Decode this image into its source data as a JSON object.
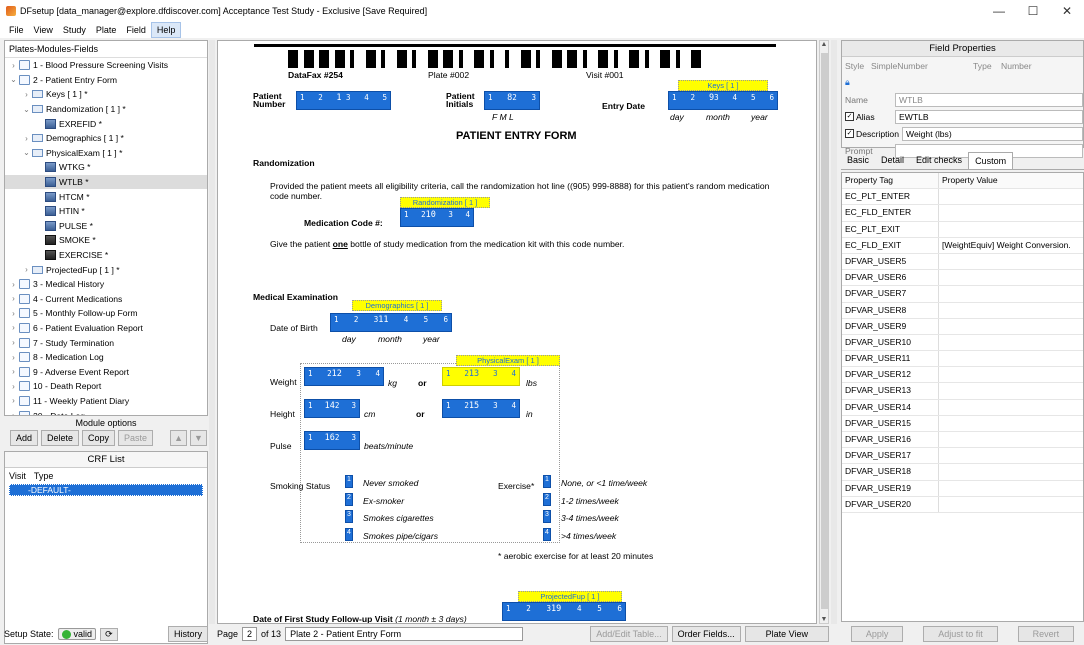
{
  "window": {
    "title": "DFsetup [data_manager@explore.dfdiscover.com] Acceptance Test Study - Exclusive [Save Required]",
    "minimize": "—",
    "maximize": "☐",
    "close": "✕"
  },
  "menu": [
    "File",
    "View",
    "Study",
    "Plate",
    "Field",
    "Help"
  ],
  "tree": {
    "header": "Plates-Modules-Fields",
    "items": [
      {
        "label": "1 - Blood Pressure Screening Visits",
        "depth": 0,
        "tw": "›",
        "icon": "doc"
      },
      {
        "label": "2 - Patient Entry Form",
        "depth": 0,
        "tw": "⌄",
        "icon": "doc"
      },
      {
        "label": "Keys [ 1 ] *",
        "depth": 1,
        "tw": "›",
        "icon": "mod"
      },
      {
        "label": "Randomization [ 1 ] *",
        "depth": 1,
        "tw": "⌄",
        "icon": "mod"
      },
      {
        "label": "EXREFID *",
        "depth": 2,
        "tw": "",
        "icon": "fld"
      },
      {
        "label": "Demographics [ 1 ] *",
        "depth": 1,
        "tw": "›",
        "icon": "mod"
      },
      {
        "label": "PhysicalExam [ 1 ] *",
        "depth": 1,
        "tw": "⌄",
        "icon": "mod"
      },
      {
        "label": "WTKG *",
        "depth": 2,
        "tw": "",
        "icon": "fld"
      },
      {
        "label": "WTLB *",
        "depth": 2,
        "tw": "",
        "icon": "fld",
        "selected": true
      },
      {
        "label": "HTCM *",
        "depth": 2,
        "tw": "",
        "icon": "fld"
      },
      {
        "label": "HTIN *",
        "depth": 2,
        "tw": "",
        "icon": "fld"
      },
      {
        "label": "PULSE *",
        "depth": 2,
        "tw": "",
        "icon": "fld"
      },
      {
        "label": "SMOKE *",
        "depth": 2,
        "tw": "",
        "icon": "fld2"
      },
      {
        "label": "EXERCISE *",
        "depth": 2,
        "tw": "",
        "icon": "fld2"
      },
      {
        "label": "ProjectedFup [ 1 ] *",
        "depth": 1,
        "tw": "›",
        "icon": "mod"
      },
      {
        "label": "3 - Medical History",
        "depth": 0,
        "tw": "›",
        "icon": "doc"
      },
      {
        "label": "4 - Current Medications",
        "depth": 0,
        "tw": "›",
        "icon": "doc"
      },
      {
        "label": "5 - Monthly Follow-up Form",
        "depth": 0,
        "tw": "›",
        "icon": "doc"
      },
      {
        "label": "6 - Patient Evaluation Report",
        "depth": 0,
        "tw": "›",
        "icon": "doc"
      },
      {
        "label": "7 - Study Termination",
        "depth": 0,
        "tw": "›",
        "icon": "doc"
      },
      {
        "label": "8 - Medication Log",
        "depth": 0,
        "tw": "›",
        "icon": "doc"
      },
      {
        "label": "9 - Adverse Event Report",
        "depth": 0,
        "tw": "›",
        "icon": "doc"
      },
      {
        "label": "10 - Death Report",
        "depth": 0,
        "tw": "›",
        "icon": "doc"
      },
      {
        "label": "11 - Weekly Patient Diary",
        "depth": 0,
        "tw": "›",
        "icon": "doc"
      },
      {
        "label": "20 - Date Log",
        "depth": 0,
        "tw": "›",
        "icon": "doc"
      },
      {
        "label": "21 - Lab Results",
        "depth": 0,
        "tw": "›",
        "icon": "doc"
      }
    ]
  },
  "module_options": {
    "label": "Module options",
    "add": "Add",
    "delete": "Delete",
    "copy": "Copy",
    "paste": "Paste",
    "up": "▲",
    "down": "▼"
  },
  "crf_list": {
    "title": "CRF List",
    "col_visit": "Visit",
    "col_type": "Type",
    "row": "-DEFAULT-"
  },
  "setup": {
    "label": "Setup State:",
    "state": "valid",
    "refresh": "⟳",
    "history": "History"
  },
  "form": {
    "barcode_fax": "DataFax #254",
    "barcode_plate": "Plate #002",
    "barcode_visit": "Visit #001",
    "keys_label": "Keys [ 1 ]",
    "patient_number": "Patient Number",
    "patient_initials": "Patient Initials",
    "entry_date": "Entry Date",
    "fml": "F   M   L",
    "day": "day",
    "month": "month",
    "year": "year",
    "title": "PATIENT ENTRY FORM",
    "randomization_heading": "Randomization",
    "rand_text": "Provided the patient meets all eligibility criteria, call the randomization hot line ((905) 999-8888) for this patient's random medication code number.",
    "rand_module": "Randomization [ 1 ]",
    "med_code": "Medication Code #:",
    "give_pre": "Give the patient ",
    "give_one": "one",
    "give_post": " bottle of study medication from the medication kit with this code number.",
    "medical_heading": "Medical Examination",
    "demo_module": "Demographics [ 1 ]",
    "dob": "Date of Birth",
    "phys_module": "PhysicalExam [ 1 ]",
    "weight": "Weight",
    "kg": "kg",
    "or1": "or",
    "lbs": "lbs",
    "height": "Height",
    "cm": "cm",
    "or2": "or",
    "in": "in",
    "pulse": "Pulse",
    "bpm": "beats/minute",
    "smoking": "Smoking Status",
    "smoke_opts": [
      "Never smoked",
      "Ex-smoker",
      "Smokes cigarettes",
      "Smokes pipe/cigars"
    ],
    "exercise": "Exercise*",
    "ex_opts": [
      "None, or <1 time/week",
      "1-2 times/week",
      "3-4 times/week",
      ">4 times/week"
    ],
    "aerobic": "* aerobic exercise for at least 20 minutes",
    "proj_module": "ProjectedFup [ 1 ]",
    "followup_pre": "Date of First Study Follow-up Visit ",
    "followup_note": "(1 month ± 3 days)",
    "fid": {
      "pnum": "1",
      "pinit": "8",
      "edate": "9",
      "mcode": "10",
      "dob": "11",
      "wtkg": "12",
      "wtlb": "13",
      "htcm": "14",
      "htin": "15",
      "pulse": "16",
      "smoke": "17",
      "exer": "18",
      "fup": "19"
    }
  },
  "pagebar": {
    "page": "Page",
    "page_num": "2",
    "of": "of 13",
    "desc": "Plate 2 - Patient Entry Form",
    "addedit": "Add/Edit Table...",
    "order": "Order Fields...",
    "view": "Plate View"
  },
  "field_props": {
    "title": "Field Properties",
    "style_lbl": "Style",
    "style_val": "SimpleNumber",
    "type_lbl": "Type",
    "type_val": "Number",
    "name_lbl": "Name",
    "name_val": "WTLB",
    "alias_lbl": "Alias",
    "alias_val": "EWTLB",
    "desc_lbl": "Description",
    "desc_val": "Weight (lbs)",
    "prompt_lbl": "Prompt",
    "prompt_val": ""
  },
  "tabs": [
    "Basic",
    "Detail",
    "Edit checks",
    "Custom"
  ],
  "prop_table": {
    "h_tag": "Property Tag",
    "h_val": "Property Value",
    "rows": [
      [
        "EC_PLT_ENTER",
        ""
      ],
      [
        "EC_FLD_ENTER",
        ""
      ],
      [
        "EC_PLT_EXIT",
        ""
      ],
      [
        "EC_FLD_EXIT",
        "[WeightEquiv] Weight Conversion."
      ],
      [
        "DFVAR_USER5",
        ""
      ],
      [
        "DFVAR_USER6",
        ""
      ],
      [
        "DFVAR_USER7",
        ""
      ],
      [
        "DFVAR_USER8",
        ""
      ],
      [
        "DFVAR_USER9",
        ""
      ],
      [
        "DFVAR_USER10",
        ""
      ],
      [
        "DFVAR_USER11",
        ""
      ],
      [
        "DFVAR_USER12",
        ""
      ],
      [
        "DFVAR_USER13",
        ""
      ],
      [
        "DFVAR_USER14",
        ""
      ],
      [
        "DFVAR_USER15",
        ""
      ],
      [
        "DFVAR_USER16",
        ""
      ],
      [
        "DFVAR_USER17",
        ""
      ],
      [
        "DFVAR_USER18",
        ""
      ],
      [
        "DFVAR_USER19",
        ""
      ],
      [
        "DFVAR_USER20",
        ""
      ]
    ]
  },
  "rbtns": {
    "apply": "Apply",
    "adjust": "Adjust to fit",
    "revert": "Revert"
  }
}
